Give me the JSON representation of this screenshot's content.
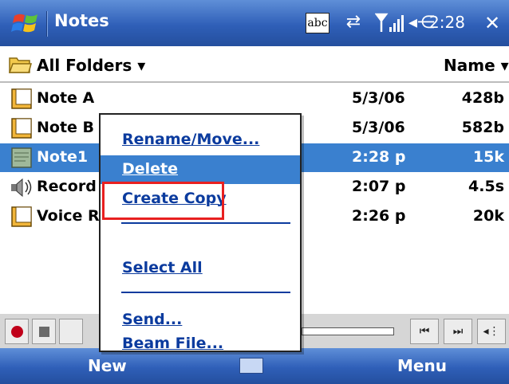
{
  "titlebar": {
    "title": "Notes",
    "input_indicator": "abc",
    "clock": "2:28",
    "close_label": "✕"
  },
  "folderbar": {
    "folder_label": "All Folders ▾",
    "sort_label": "Name ▾"
  },
  "files": [
    {
      "name": "Note A",
      "date": "5/3/06",
      "size": "428b",
      "icon": "note-folder-icon"
    },
    {
      "name": "Note B",
      "date": "5/3/06",
      "size": "582b",
      "icon": "note-folder-icon"
    },
    {
      "name": "Note1",
      "date": "2:28 p",
      "size": "15k",
      "icon": "note-file-icon",
      "selected": true
    },
    {
      "name": "Record",
      "date": "2:07 p",
      "size": "4.5s",
      "icon": "recording-icon"
    },
    {
      "name": "Voice R",
      "date": "2:26 p",
      "size": "20k",
      "icon": "note-folder-icon"
    }
  ],
  "context_menu": {
    "items": [
      "Rename/Move...",
      "Delete",
      "Create Copy",
      "Select All",
      "Send...",
      "Beam File..."
    ],
    "highlighted": "Delete"
  },
  "menubar": {
    "left": "New",
    "right": "Menu"
  },
  "colors": {
    "titlebar": "#2f5fb8",
    "selection": "#3a80cf",
    "menu_text": "#0b3b9e",
    "annotation": "#e82020"
  }
}
